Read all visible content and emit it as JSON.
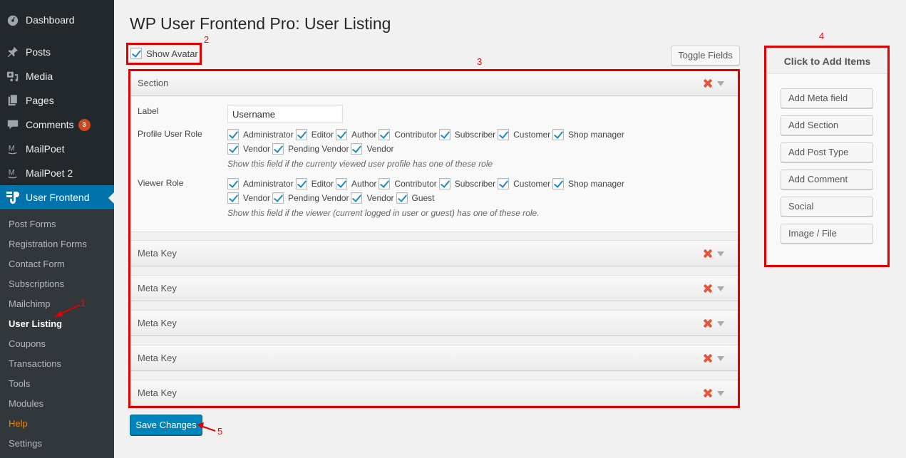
{
  "sidebar": {
    "menu": [
      {
        "label": "Dashboard",
        "icon": "dashboard-icon"
      },
      {
        "label": "Posts",
        "icon": "pin-icon"
      },
      {
        "label": "Media",
        "icon": "media-icon"
      },
      {
        "label": "Pages",
        "icon": "pages-icon"
      },
      {
        "label": "Comments",
        "icon": "comment-icon",
        "badge": "3"
      },
      {
        "label": "MailPoet",
        "icon": "mailpoet-icon"
      },
      {
        "label": "MailPoet 2",
        "icon": "mailpoet-icon"
      },
      {
        "label": "User Frontend",
        "icon": "user-frontend-icon",
        "current": true
      }
    ],
    "submenu": [
      {
        "label": "Post Forms"
      },
      {
        "label": "Registration Forms"
      },
      {
        "label": "Contact Form"
      },
      {
        "label": "Subscriptions"
      },
      {
        "label": "Mailchimp"
      },
      {
        "label": "User Listing",
        "current": true
      },
      {
        "label": "Coupons"
      },
      {
        "label": "Transactions"
      },
      {
        "label": "Tools"
      },
      {
        "label": "Modules"
      },
      {
        "label": "Help"
      },
      {
        "label": "Settings"
      }
    ]
  },
  "page": {
    "title": "WP User Frontend Pro: User Listing",
    "show_avatar_label": "Show Avatar",
    "show_avatar_checked": true,
    "toggle_fields_label": "Toggle Fields",
    "save_label": "Save Changes"
  },
  "section": {
    "title": "Section",
    "label_field_label": "Label",
    "label_value": "Username",
    "profile_role_label": "Profile User Role",
    "profile_roles_row1": [
      "Administrator",
      "Editor",
      "Author",
      "Contributor",
      "Subscriber",
      "Customer",
      "Shop manager"
    ],
    "profile_roles_row2": [
      "Vendor",
      "Pending Vendor",
      "Vendor"
    ],
    "profile_help": "Show this field if the currenty viewed user profile has one of these role",
    "viewer_role_label": "Viewer Role",
    "viewer_roles_row1": [
      "Administrator",
      "Editor",
      "Author",
      "Contributor",
      "Subscriber",
      "Customer",
      "Shop manager"
    ],
    "viewer_roles_row2": [
      "Vendor",
      "Pending Vendor",
      "Vendor",
      "Guest"
    ],
    "viewer_help": "Show this field if the viewer (current logged in user or guest) has one of these role."
  },
  "meta_fields": [
    "Meta Key",
    "Meta Key",
    "Meta Key",
    "Meta Key",
    "Meta Key"
  ],
  "add_box": {
    "title": "Click to Add Items",
    "buttons": [
      "Add Meta field",
      "Add Section",
      "Add Post Type",
      "Add Comment",
      "Social",
      "Image / File"
    ]
  },
  "annotations": {
    "a1": "1",
    "a2": "2",
    "a3": "3",
    "a4": "4",
    "a5": "5"
  },
  "colors": {
    "accent": "#0073aa",
    "annotation": "#e00000",
    "delete": "#e4573c"
  }
}
